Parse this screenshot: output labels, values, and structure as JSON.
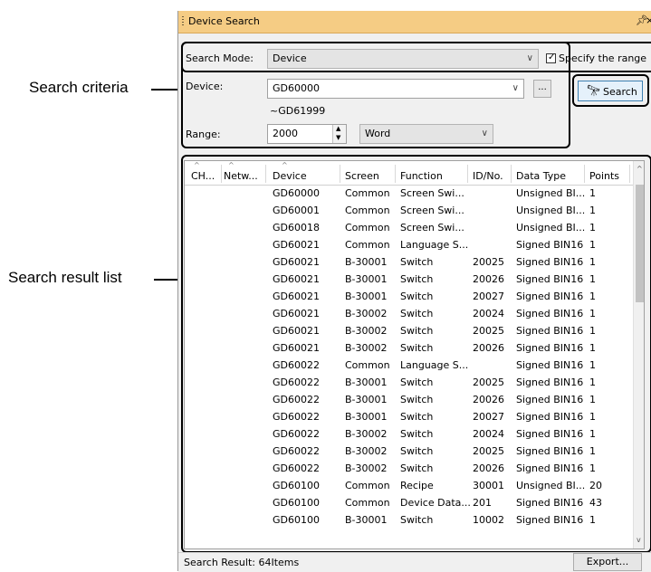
{
  "callouts": {
    "search_criteria": "Search criteria",
    "search_result_list": "Search result list"
  },
  "panel": {
    "title": "Device Search",
    "pin_icon": "pin-icon",
    "close_icon": "close-icon"
  },
  "criteria": {
    "search_mode_label": "Search Mode:",
    "search_mode_value": "Device",
    "specify_range_label": "Specify the range",
    "specify_range_checked": true,
    "device_label": "Device:",
    "device_value": "GD60000",
    "device_range_end": "~GD61999",
    "browse_label": "...",
    "search_button": "Search",
    "range_label": "Range:",
    "range_value": "2000",
    "range_unit": "Word"
  },
  "table": {
    "columns": [
      "CH...",
      "Netw...",
      "Device",
      "Screen",
      "Function",
      "ID/No.",
      "Data Type",
      "Points"
    ],
    "rows": [
      [
        "",
        "",
        "GD60000",
        "Common",
        "Screen Swi...",
        "",
        "Unsigned BI...",
        "1"
      ],
      [
        "",
        "",
        "GD60001",
        "Common",
        "Screen Swi...",
        "",
        "Unsigned BI...",
        "1"
      ],
      [
        "",
        "",
        "GD60018",
        "Common",
        "Screen Swi...",
        "",
        "Unsigned BI...",
        "1"
      ],
      [
        "",
        "",
        "GD60021",
        "Common",
        "Language S...",
        "",
        "Signed BIN16",
        "1"
      ],
      [
        "",
        "",
        "GD60021",
        "B-30001",
        "Switch",
        "20025",
        "Signed BIN16",
        "1"
      ],
      [
        "",
        "",
        "GD60021",
        "B-30001",
        "Switch",
        "20026",
        "Signed BIN16",
        "1"
      ],
      [
        "",
        "",
        "GD60021",
        "B-30001",
        "Switch",
        "20027",
        "Signed BIN16",
        "1"
      ],
      [
        "",
        "",
        "GD60021",
        "B-30002",
        "Switch",
        "20024",
        "Signed BIN16",
        "1"
      ],
      [
        "",
        "",
        "GD60021",
        "B-30002",
        "Switch",
        "20025",
        "Signed BIN16",
        "1"
      ],
      [
        "",
        "",
        "GD60021",
        "B-30002",
        "Switch",
        "20026",
        "Signed BIN16",
        "1"
      ],
      [
        "",
        "",
        "GD60022",
        "Common",
        "Language S...",
        "",
        "Signed BIN16",
        "1"
      ],
      [
        "",
        "",
        "GD60022",
        "B-30001",
        "Switch",
        "20025",
        "Signed BIN16",
        "1"
      ],
      [
        "",
        "",
        "GD60022",
        "B-30001",
        "Switch",
        "20026",
        "Signed BIN16",
        "1"
      ],
      [
        "",
        "",
        "GD60022",
        "B-30001",
        "Switch",
        "20027",
        "Signed BIN16",
        "1"
      ],
      [
        "",
        "",
        "GD60022",
        "B-30002",
        "Switch",
        "20024",
        "Signed BIN16",
        "1"
      ],
      [
        "",
        "",
        "GD60022",
        "B-30002",
        "Switch",
        "20025",
        "Signed BIN16",
        "1"
      ],
      [
        "",
        "",
        "GD60022",
        "B-30002",
        "Switch",
        "20026",
        "Signed BIN16",
        "1"
      ],
      [
        "",
        "",
        "GD60100",
        "Common",
        "Recipe",
        "30001",
        "Unsigned BI...",
        "20"
      ],
      [
        "",
        "",
        "GD60100",
        "Common",
        "Device Data...",
        "201",
        "Signed BIN16",
        "43"
      ],
      [
        "",
        "",
        "GD60100",
        "B-30001",
        "Switch",
        "10002",
        "Signed BIN16",
        "1"
      ]
    ]
  },
  "status": {
    "result_text": "Search Result: 64Items",
    "export_button": "Export..."
  }
}
